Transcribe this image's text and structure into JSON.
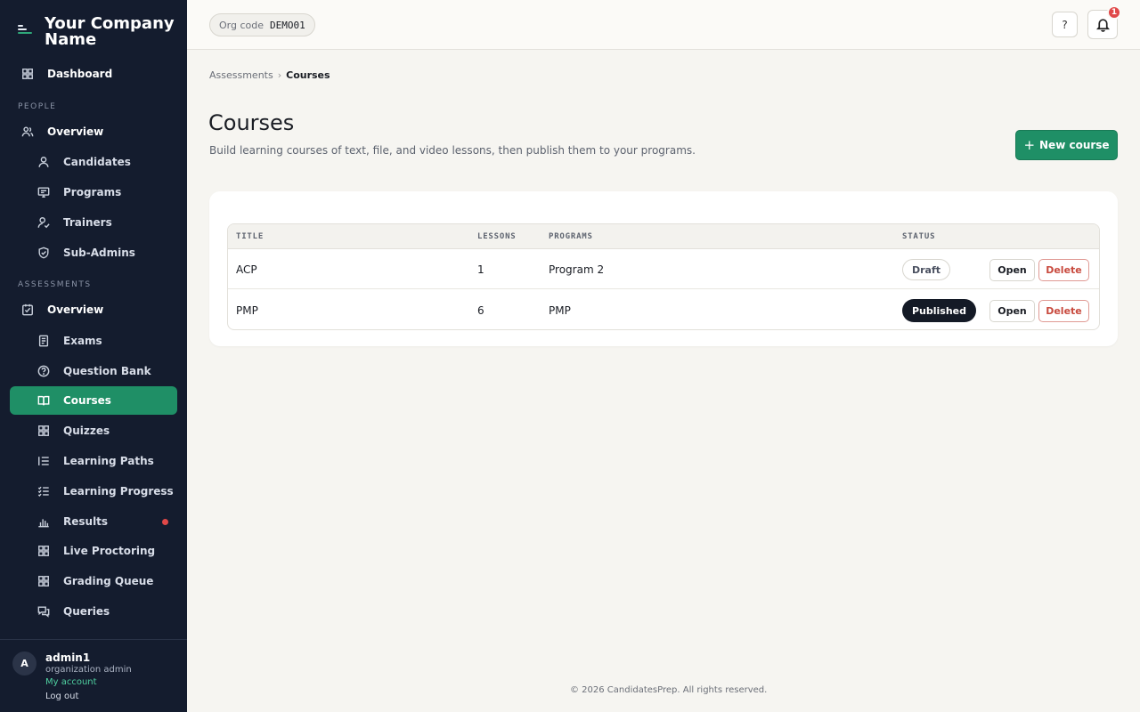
{
  "brand": {
    "name": "Your Company Name"
  },
  "sidebar": {
    "sections": {
      "people": "PEOPLE",
      "assessments": "ASSESSMENTS"
    },
    "items": [
      {
        "label": "Dashboard",
        "icon": "grid-icon"
      },
      {
        "label": "Overview",
        "icon": "users-icon"
      },
      {
        "label": "Candidates",
        "icon": "user-icon"
      },
      {
        "label": "Programs",
        "icon": "monitor-icon"
      },
      {
        "label": "Trainers",
        "icon": "user-check-icon"
      },
      {
        "label": "Sub-Admins",
        "icon": "shield-icon"
      },
      {
        "label": "Overview",
        "icon": "checkbox-icon"
      },
      {
        "label": "Exams",
        "icon": "document-icon"
      },
      {
        "label": "Question Bank",
        "icon": "question-circle-icon"
      },
      {
        "label": "Courses",
        "icon": "book-icon",
        "active": true
      },
      {
        "label": "Quizzes",
        "icon": "grid-icon"
      },
      {
        "label": "Learning Paths",
        "icon": "list-icon"
      },
      {
        "label": "Learning Progress",
        "icon": "checklist-icon"
      },
      {
        "label": "Results",
        "icon": "bar-chart-icon",
        "notification": true
      },
      {
        "label": "Live Proctoring",
        "icon": "grid-icon"
      },
      {
        "label": "Grading Queue",
        "icon": "grid-icon"
      },
      {
        "label": "Queries",
        "icon": "chat-icon"
      }
    ]
  },
  "user": {
    "initial": "A",
    "name": "admin1",
    "role": "organization admin",
    "account_link": "My account",
    "logout_link": "Log out"
  },
  "topbar": {
    "org_label": "Org code",
    "org_code": "DEMO01",
    "help_label": "?",
    "notification_count": "1"
  },
  "breadcrumb": {
    "parent": "Assessments",
    "separator": "›",
    "current": "Courses"
  },
  "page": {
    "title": "Courses",
    "subtitle": "Build learning courses of text, file, and video lessons, then publish them to your programs.",
    "new_button": "New course"
  },
  "table": {
    "headers": {
      "title": "TITLE",
      "lessons": "LESSONS",
      "programs": "PROGRAMS",
      "status": "STATUS"
    },
    "rows": [
      {
        "title": "ACP",
        "lessons": "1",
        "programs": "Program 2",
        "status": "Draft",
        "open": "Open",
        "delete": "Delete"
      },
      {
        "title": "PMP",
        "lessons": "6",
        "programs": "PMP",
        "status": "Published",
        "open": "Open",
        "delete": "Delete"
      }
    ]
  },
  "footer": {
    "text": "© 2026 CandidatesPrep. All rights reserved."
  },
  "colors": {
    "sidebar_bg": "#141c2e",
    "accent": "#1f8f66",
    "danger": "#c84a3e",
    "badge_red": "#e04848"
  }
}
